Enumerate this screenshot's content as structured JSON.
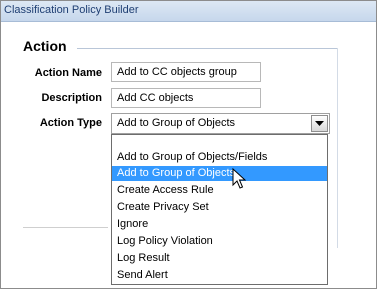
{
  "window": {
    "title": "Classification Policy Builder"
  },
  "section": {
    "title": "Action"
  },
  "form": {
    "action_name": {
      "label": "Action Name",
      "value": "Add to CC objects group"
    },
    "description": {
      "label": "Description",
      "value": "Add CC objects"
    },
    "action_type": {
      "label": "Action Type",
      "value": "Add to Group of Objects"
    }
  },
  "dropdown": {
    "options": [
      "Add to Group of Objects/Fields",
      "Add to Group of Objects",
      "Create Access Rule",
      "Create Privacy Set",
      "Ignore",
      "Log Policy Violation",
      "Log Result",
      "Send Alert"
    ],
    "selected_index": 1
  },
  "colors": {
    "selection": "#3399ff",
    "titlebar": "#c6d7ec",
    "title_text": "#1f3f73"
  },
  "icons": {
    "dropdown_arrow": "chevron-down-icon",
    "pointer": "mouse-pointer-icon"
  }
}
